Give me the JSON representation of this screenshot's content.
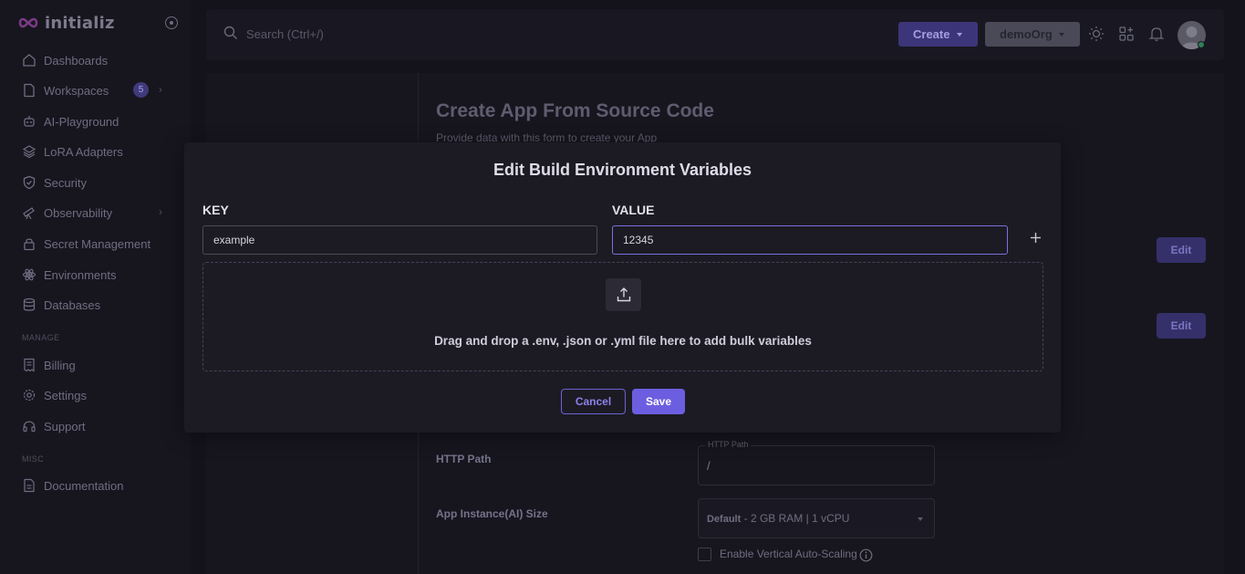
{
  "app": {
    "name": "initializ"
  },
  "sidebar": {
    "items": [
      {
        "label": "Dashboards",
        "icon": "home-icon"
      },
      {
        "label": "Workspaces",
        "icon": "file-icon",
        "badge": "5"
      },
      {
        "label": "AI-Playground",
        "icon": "robot-icon"
      },
      {
        "label": "LoRA Adapters",
        "icon": "layers-icon"
      },
      {
        "label": "Security",
        "icon": "shield-icon"
      },
      {
        "label": "Observability",
        "icon": "telescope-icon"
      },
      {
        "label": "Secret Management",
        "icon": "lock-icon"
      },
      {
        "label": "Environments",
        "icon": "atom-icon"
      },
      {
        "label": "Databases",
        "icon": "database-icon"
      }
    ],
    "manage_heading": "MANAGE",
    "manage_items": [
      {
        "label": "Billing",
        "icon": "receipt-icon"
      },
      {
        "label": "Settings",
        "icon": "gear-icon"
      },
      {
        "label": "Support",
        "icon": "headset-icon"
      }
    ],
    "misc_heading": "MISC",
    "misc_items": [
      {
        "label": "Documentation",
        "icon": "document-icon"
      }
    ]
  },
  "topbar": {
    "search_placeholder": "Search (Ctrl+/)",
    "create_label": "Create",
    "org_label": "demoOrg"
  },
  "page": {
    "title": "Create App From Source Code",
    "subtitle": "Provide data with this form to create your App",
    "edit_label_1": "Edit",
    "edit_label_2": "Edit",
    "http_path_label": "HTTP Path",
    "http_path_legend": "HTTP Path",
    "http_path_value": "/",
    "instance_size_label": "App Instance(AI) Size",
    "instance_size_default": "Default",
    "instance_size_value": " - 2 GB RAM | 1 vCPU",
    "autoscaling_label": "Enable Vertical Auto-Scaling"
  },
  "modal": {
    "title": "Edit Build Environment Variables",
    "key_label": "KEY",
    "value_label": "VALUE",
    "key_value": "example",
    "value_value": "12345",
    "drop_text": "Drag and drop a .env, .json or .yml file here to add bulk variables",
    "cancel_label": "Cancel",
    "save_label": "Save"
  },
  "colors": {
    "accent": "#6c5ee0",
    "background": "#14131c",
    "modal": "#1c1b24",
    "online_status": "#2f7d56"
  }
}
